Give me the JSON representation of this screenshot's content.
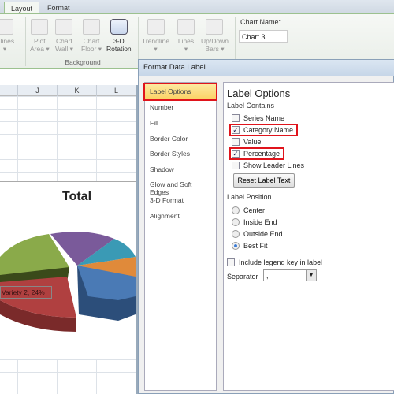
{
  "ribbon": {
    "tabs": [
      "Layout",
      "Format"
    ],
    "buttons": [
      {
        "label": "idlines",
        "sub": "▾"
      },
      {
        "label": "Plot",
        "sub": "Area ▾"
      },
      {
        "label": "Chart",
        "sub": "Wall ▾"
      },
      {
        "label": "Chart",
        "sub": "Floor ▾"
      },
      {
        "label": "3-D",
        "sub": "Rotation"
      },
      {
        "label": "Trendline",
        "sub": "▾"
      },
      {
        "label": "Lines",
        "sub": "▾"
      },
      {
        "label": "Up/Down",
        "sub": "Bars ▾"
      }
    ],
    "group_background": "Background",
    "chart_name_label": "Chart Name:",
    "chart_name_value": "Chart 3"
  },
  "sheet": {
    "columns": [
      "J",
      "K",
      "L"
    ]
  },
  "chart": {
    "title": "Total",
    "selected_label": "Variety 2, 24%",
    "colors": {
      "blue": "#4a7ab5",
      "red": "#b04040",
      "green": "#8aaa4a",
      "purple": "#7a5a9a",
      "teal": "#3a9ab5",
      "orange": "#e08a3a"
    }
  },
  "dialog": {
    "title": "Format Data Label",
    "nav": [
      "Label Options",
      "Number",
      "Fill",
      "Border Color",
      "Border Styles",
      "Shadow",
      "Glow and Soft Edges",
      "3-D Format",
      "Alignment"
    ],
    "heading": "Label Options",
    "label_contains": "Label Contains",
    "checks": [
      {
        "label": "Series Name",
        "checked": false
      },
      {
        "label": "Category Name",
        "checked": true
      },
      {
        "label": "Value",
        "checked": false
      },
      {
        "label": "Percentage",
        "checked": true
      },
      {
        "label": "Show Leader Lines",
        "checked": false
      }
    ],
    "reset_button": "Reset Label Text",
    "label_position": "Label Position",
    "positions": [
      {
        "label": "Center",
        "selected": false
      },
      {
        "label": "Inside End",
        "selected": false
      },
      {
        "label": "Outside End",
        "selected": false
      },
      {
        "label": "Best Fit",
        "selected": true
      }
    ],
    "legend_key": "Include legend key in label",
    "separator_label": "Separator",
    "separator_value": ","
  }
}
